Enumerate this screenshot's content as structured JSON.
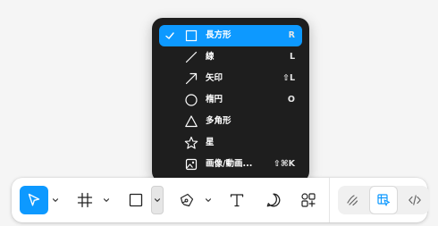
{
  "menu": {
    "items": [
      {
        "label": "長方形",
        "shortcut": "R",
        "icon": "rectangle-icon",
        "selected": true
      },
      {
        "label": "線",
        "shortcut": "L",
        "icon": "line-icon",
        "selected": false
      },
      {
        "label": "矢印",
        "shortcut": "⇧L",
        "icon": "arrow-icon",
        "selected": false
      },
      {
        "label": "楕円",
        "shortcut": "O",
        "icon": "ellipse-icon",
        "selected": false
      },
      {
        "label": "多角形",
        "shortcut": "",
        "icon": "polygon-icon",
        "selected": false
      },
      {
        "label": "星",
        "shortcut": "",
        "icon": "star-icon",
        "selected": false
      },
      {
        "label": "画像/動画...",
        "shortcut": "⇧⌘K",
        "icon": "image-icon",
        "selected": false
      }
    ]
  },
  "toolbar": {
    "tools": [
      {
        "name": "move-tool",
        "icon": "cursor-icon",
        "active": true
      },
      {
        "name": "frame-tool",
        "icon": "frame-icon",
        "active": false
      },
      {
        "name": "shape-tool",
        "icon": "rectangle-icon",
        "active": false
      },
      {
        "name": "pen-tool",
        "icon": "pen-icon",
        "active": false
      },
      {
        "name": "text-tool",
        "icon": "text-icon",
        "active": false
      },
      {
        "name": "comment-tool",
        "icon": "comment-icon",
        "active": false
      },
      {
        "name": "actions-tool",
        "icon": "shapes-plus-icon",
        "active": false
      }
    ],
    "modes": [
      {
        "name": "draw-mode",
        "icon": "draw-icon",
        "active": false
      },
      {
        "name": "design-mode",
        "icon": "design-icon",
        "active": true
      },
      {
        "name": "dev-mode",
        "icon": "code-icon",
        "active": false
      }
    ]
  },
  "colors": {
    "accent": "#0d99ff",
    "menu_bg": "#1e1e1e",
    "toolbar_bg": "#ffffff",
    "page_bg": "#f5f5f5"
  }
}
